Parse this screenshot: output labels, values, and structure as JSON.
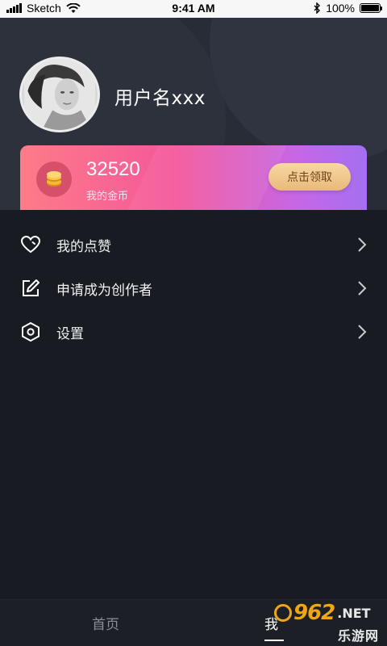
{
  "status_bar": {
    "carrier": "Sketch",
    "time": "9:41 AM",
    "battery_text": "100%",
    "battery_level": 1.0
  },
  "profile": {
    "username": "用户名xxx"
  },
  "coins": {
    "value": "32520",
    "label": "我的金币",
    "claim_label": "点击领取",
    "gradient_start": "#fe7b88",
    "gradient_end": "#a46ff1"
  },
  "menu": {
    "items": [
      {
        "label": "我的点赞",
        "icon": "heart-icon"
      },
      {
        "label": "申请成为创作者",
        "icon": "edit-icon"
      },
      {
        "label": "设置",
        "icon": "settings-hexagon-icon"
      }
    ]
  },
  "tabbar": {
    "tabs": [
      {
        "label": "首页",
        "active": false
      },
      {
        "label": "我",
        "active": true
      }
    ]
  },
  "watermark": {
    "number": "962",
    "domain": ".NET",
    "subtitle": "乐游网"
  }
}
